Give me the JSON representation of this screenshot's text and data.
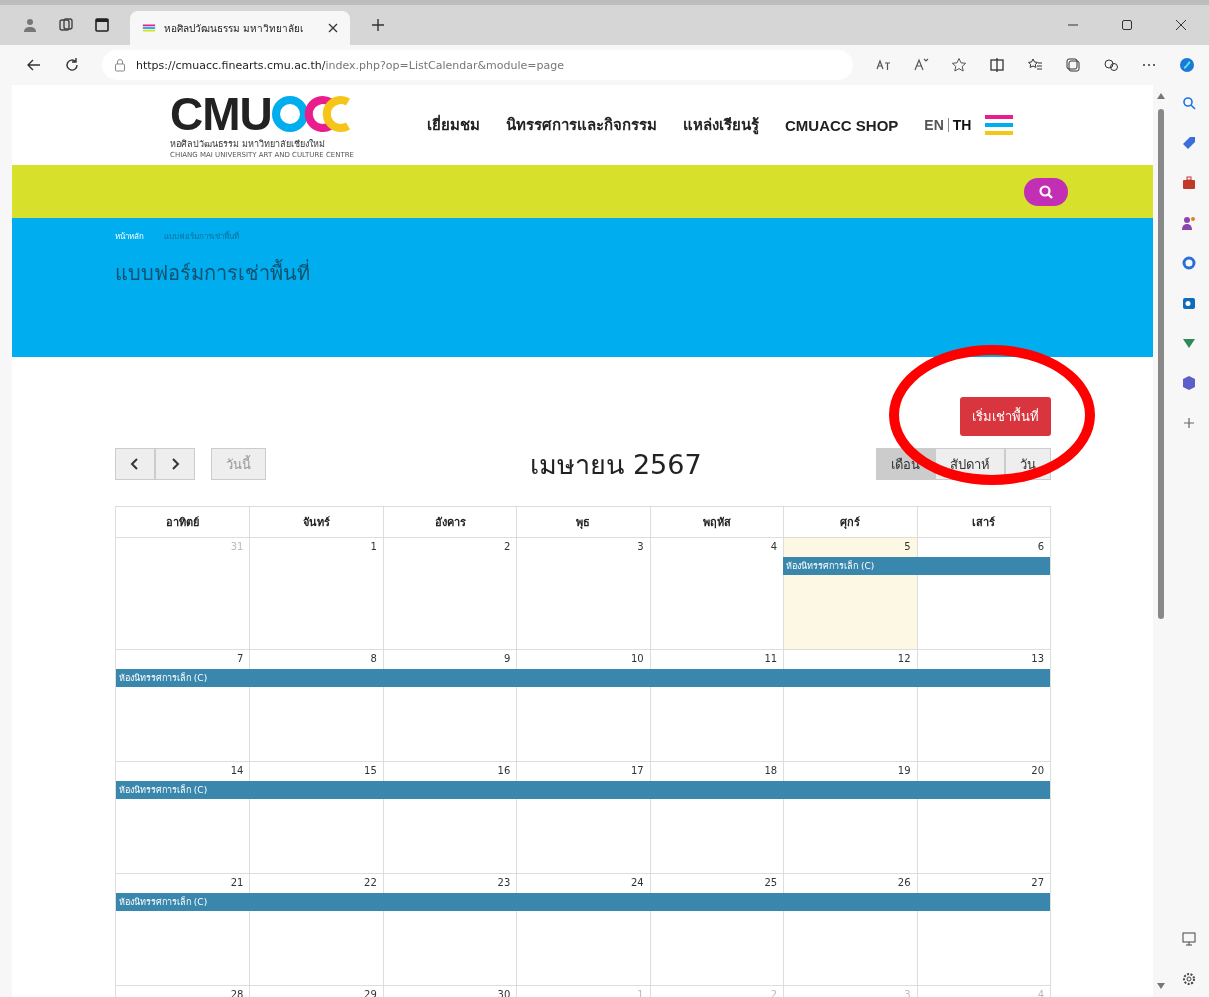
{
  "browser": {
    "tab_title": "หอศิลปวัฒนธรรม มหาวิทยาลัยเ",
    "url_host": "https://cmuacc.finearts.cmu.ac.th/",
    "url_path": "index.php?op=ListCalendar&module=page"
  },
  "header": {
    "logo_text": "CMU",
    "logo_subtitle": "หอศิลปวัฒนธรรม มหาวิทยาลัยเชียงใหม่",
    "logo_english": "CHIANG MAI UNIVERSITY ART AND CULTURE CENTRE",
    "nav": [
      "เยี่ยมชม",
      "นิทรรศการและกิจกรรม",
      "แหล่งเรียนรู้",
      "CMUACC SHOP"
    ],
    "languages": [
      {
        "label": "EN",
        "selected": false
      },
      {
        "label": "TH",
        "selected": true
      }
    ]
  },
  "breadcrumb": [
    "หน้าหลัก",
    "แบบฟอร์มการเช่าพื้นที่"
  ],
  "page_title": "แบบฟอร์มการเช่าพื้นที่",
  "rent_button": "เริ่มเช่าพื้นที่",
  "calendar": {
    "today_button": "วันนี้",
    "title": "เมษายน 2567",
    "views": [
      {
        "label": "เดือน",
        "selected": true
      },
      {
        "label": "สัปดาห์",
        "selected": false
      },
      {
        "label": "วัน",
        "selected": false
      }
    ],
    "weekdays": [
      "อาทิตย์",
      "จันทร์",
      "อังคาร",
      "พุธ",
      "พฤหัส",
      "ศุกร์",
      "เสาร์"
    ],
    "weeks": [
      {
        "event_title": "ห้องนิทรรศการเล็ก (C)",
        "days": [
          {
            "label": "31",
            "other_month": true,
            "today": false,
            "has_event": false
          },
          {
            "label": "1",
            "other_month": false,
            "today": false,
            "has_event": false
          },
          {
            "label": "2",
            "other_month": false,
            "today": false,
            "has_event": false
          },
          {
            "label": "3",
            "other_month": false,
            "today": false,
            "has_event": false
          },
          {
            "label": "4",
            "other_month": false,
            "today": false,
            "has_event": false
          },
          {
            "label": "5",
            "other_month": false,
            "today": true,
            "has_event": true
          },
          {
            "label": "6",
            "other_month": false,
            "today": false,
            "has_event": true
          }
        ]
      },
      {
        "event_title": "ห้องนิทรรศการเล็ก (C)",
        "days": [
          {
            "label": "7",
            "other_month": false,
            "today": false,
            "has_event": true
          },
          {
            "label": "8",
            "other_month": false,
            "today": false,
            "has_event": true
          },
          {
            "label": "9",
            "other_month": false,
            "today": false,
            "has_event": true
          },
          {
            "label": "10",
            "other_month": false,
            "today": false,
            "has_event": true
          },
          {
            "label": "11",
            "other_month": false,
            "today": false,
            "has_event": true
          },
          {
            "label": "12",
            "other_month": false,
            "today": false,
            "has_event": true
          },
          {
            "label": "13",
            "other_month": false,
            "today": false,
            "has_event": true
          }
        ]
      },
      {
        "event_title": "ห้องนิทรรศการเล็ก (C)",
        "days": [
          {
            "label": "14",
            "other_month": false,
            "today": false,
            "has_event": true
          },
          {
            "label": "15",
            "other_month": false,
            "today": false,
            "has_event": true
          },
          {
            "label": "16",
            "other_month": false,
            "today": false,
            "has_event": true
          },
          {
            "label": "17",
            "other_month": false,
            "today": false,
            "has_event": true
          },
          {
            "label": "18",
            "other_month": false,
            "today": false,
            "has_event": true
          },
          {
            "label": "19",
            "other_month": false,
            "today": false,
            "has_event": true
          },
          {
            "label": "20",
            "other_month": false,
            "today": false,
            "has_event": true
          }
        ]
      },
      {
        "event_title": "ห้องนิทรรศการเล็ก (C)",
        "days": [
          {
            "label": "21",
            "other_month": false,
            "today": false,
            "has_event": true
          },
          {
            "label": "22",
            "other_month": false,
            "today": false,
            "has_event": true
          },
          {
            "label": "23",
            "other_month": false,
            "today": false,
            "has_event": true
          },
          {
            "label": "24",
            "other_month": false,
            "today": false,
            "has_event": true
          },
          {
            "label": "25",
            "other_month": false,
            "today": false,
            "has_event": true
          },
          {
            "label": "26",
            "other_month": false,
            "today": false,
            "has_event": true
          },
          {
            "label": "27",
            "other_month": false,
            "today": false,
            "has_event": true
          }
        ]
      },
      {
        "days": [
          {
            "label": "28",
            "other_month": false,
            "today": false,
            "has_event": false
          },
          {
            "label": "29",
            "other_month": false,
            "today": false,
            "has_event": false
          },
          {
            "label": "30",
            "other_month": false,
            "today": false,
            "has_event": false
          },
          {
            "label": "1",
            "other_month": true,
            "today": false,
            "has_event": false
          },
          {
            "label": "2",
            "other_month": true,
            "today": false,
            "has_event": false
          },
          {
            "label": "3",
            "other_month": true,
            "today": false,
            "has_event": false
          },
          {
            "label": "4",
            "other_month": true,
            "today": false,
            "has_event": false
          }
        ]
      }
    ]
  }
}
